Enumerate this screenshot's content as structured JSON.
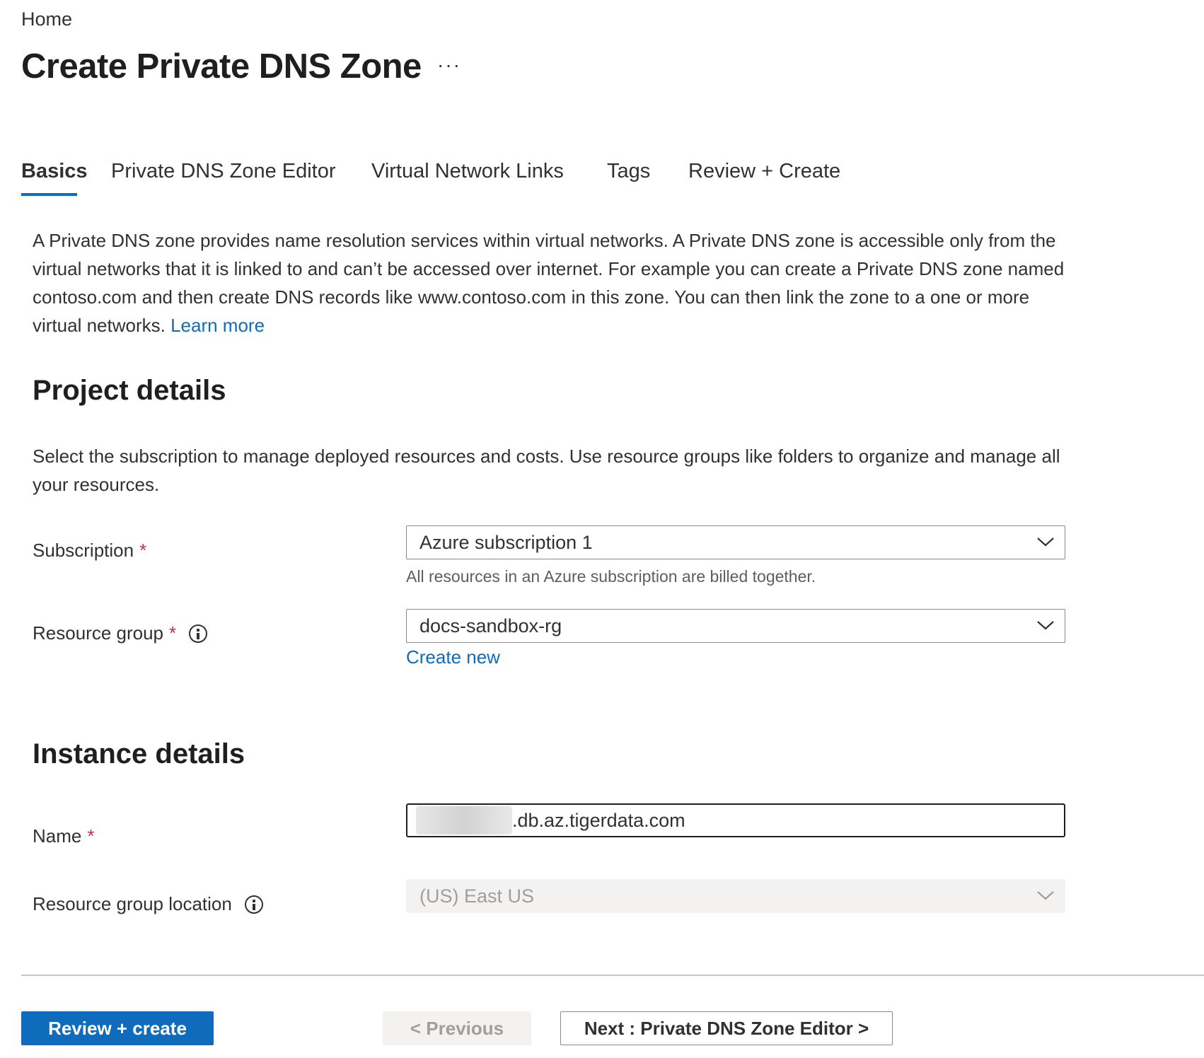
{
  "breadcrumb": "Home",
  "page": {
    "title": "Create Private DNS Zone",
    "more": "···"
  },
  "tabs": [
    {
      "label": "Basics",
      "active": true
    },
    {
      "label": "Private DNS Zone Editor"
    },
    {
      "label": "Virtual Network Links"
    },
    {
      "label": "Tags"
    },
    {
      "label": "Review + Create"
    }
  ],
  "intro": {
    "text": "A Private DNS zone provides name resolution services within virtual networks. A Private DNS zone is accessible only from the virtual networks that it is linked to and can’t be accessed over internet. For example you can create a Private DNS zone named contoso.com and then create DNS records like www.contoso.com in this zone. You can then link the zone to a one or more virtual networks. ",
    "link": "Learn more"
  },
  "project": {
    "heading": "Project details",
    "description": "Select the subscription to manage deployed resources and costs. Use resource groups like folders to organize and manage all your resources.",
    "subscription": {
      "label": "Subscription",
      "required": "*",
      "value": "Azure subscription 1",
      "hint": "All resources in an Azure subscription are billed together."
    },
    "resource_group": {
      "label": "Resource group",
      "required": "*",
      "value": "docs-sandbox-rg",
      "create_link": "Create new"
    }
  },
  "instance": {
    "heading": "Instance details",
    "name": {
      "label": "Name",
      "required": "*",
      "value_suffix": ".db.az.tigerdata.com"
    },
    "location": {
      "label": "Resource group location",
      "value": "(US) East US"
    }
  },
  "footer": {
    "review_create": "Review + create",
    "previous": "< Previous",
    "next": "Next : Private DNS Zone Editor >"
  },
  "colors": {
    "accent": "#0f6cbd",
    "required": "#c4314b"
  }
}
